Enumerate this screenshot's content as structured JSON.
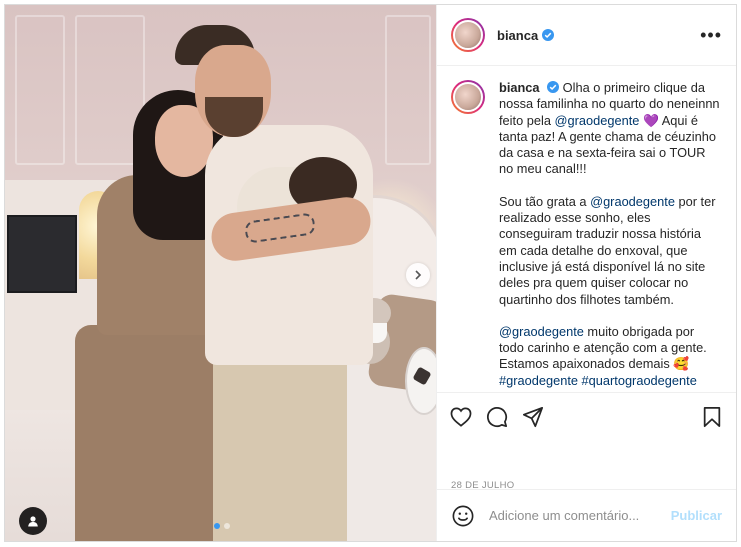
{
  "post": {
    "username": "bianca",
    "verified": true,
    "more_label": "•••",
    "date": "28 DE JULHO"
  },
  "caption": {
    "username": "bianca",
    "line1_a": "Olha o primeiro clique da nossa familinha no quarto do neneinnn feito pela ",
    "mention1": "@graodegente",
    "line1_b": " Aqui é tanta paz! A gente chama de céuzinho da casa e na sexta-feira sai o TOUR no meu canal!!!",
    "heart_emoji": "💜",
    "p2_a": "Sou tão grata a ",
    "mention2": "@graodegente",
    "p2_b": " por ter realizado esse sonho, eles conseguiram traduzir nossa história em cada detalhe do enxoval, que inclusive já está disponível lá no site deles pra quem quiser colocar no quartinho dos filhotes também.",
    "mention3": "@graodegente",
    "p3_a": " muito obrigada por todo carinho e atenção com a gente. Estamos apaixonados demais ",
    "p3_emoji": "🥰",
    "hashtags": "#graodegente #quartograodegente"
  },
  "comment": {
    "placeholder": "Adicione um comentário...",
    "publish_label": "Publicar"
  },
  "carousel": {
    "total": 2,
    "current": 1
  },
  "colors": {
    "accent": "#3897f0",
    "link": "#00376b",
    "publish_disabled": "#b2dffc",
    "muted": "#8e8e8e"
  },
  "icons": {
    "like": "heart-icon",
    "comment": "comment-icon",
    "share": "paper-plane-icon",
    "save": "bookmark-icon",
    "emoji": "smiley-icon",
    "tag": "user-tag-icon",
    "next": "chevron-right-icon",
    "verified": "verified-badge-icon"
  }
}
